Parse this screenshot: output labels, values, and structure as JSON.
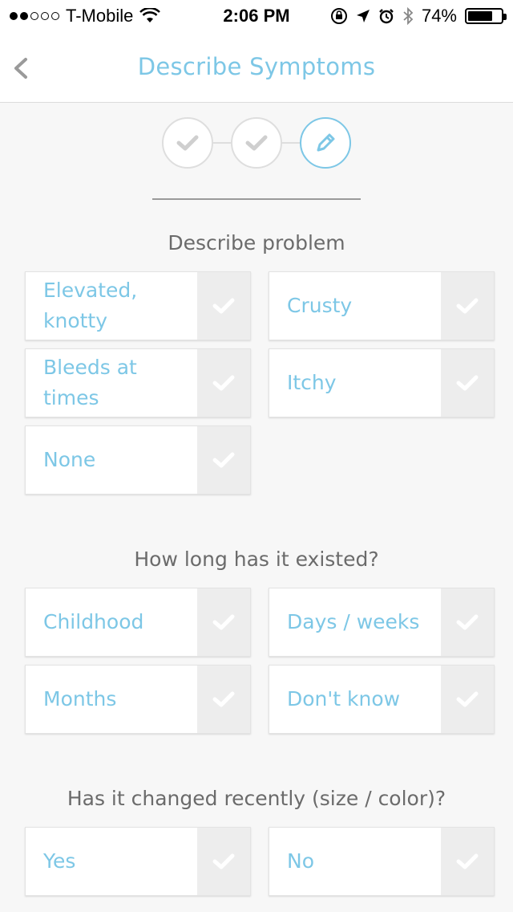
{
  "status_bar": {
    "carrier": "T-Mobile",
    "time": "2:06 PM",
    "battery": "74%",
    "battery_level": 0.74
  },
  "nav": {
    "title": "Describe Symptoms",
    "back_icon": "chevron-left-icon"
  },
  "stepper": {
    "steps": [
      {
        "state": "done",
        "icon": "check-icon"
      },
      {
        "state": "done",
        "icon": "check-icon"
      },
      {
        "state": "active",
        "icon": "pencil-icon"
      }
    ]
  },
  "sections": [
    {
      "title": "Describe problem",
      "options": [
        "Elevated, knotty",
        "Crusty",
        "Bleeds at times",
        "Itchy",
        "None"
      ]
    },
    {
      "title": "How long has it existed?",
      "options": [
        "Childhood",
        "Days / weeks",
        "Months",
        "Don't know"
      ]
    },
    {
      "title": "Has it changed recently (size / color)?",
      "options": [
        "Yes",
        "No"
      ]
    }
  ],
  "colors": {
    "accent": "#7dc7e6",
    "background": "#f7f7f7",
    "check_bg": "#ededed",
    "check_mark": "#ffffff"
  }
}
